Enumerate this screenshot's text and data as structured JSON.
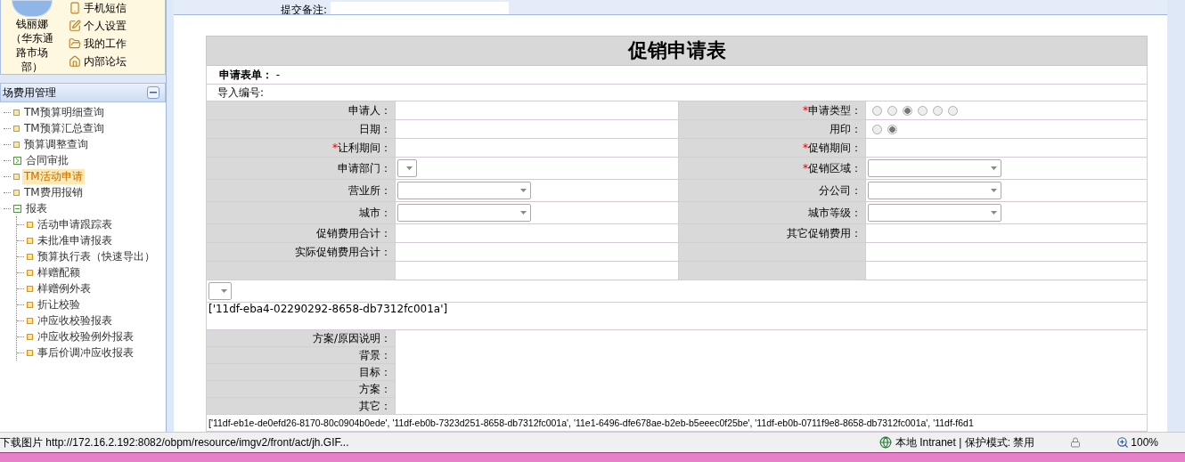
{
  "toolbar": {
    "label": "提交备注:"
  },
  "user": {
    "name": "钱丽娜（华东通路市场部）",
    "links": [
      "手机短信",
      "个人设置",
      "我的工作",
      "内部论坛"
    ]
  },
  "menu": {
    "title": "场费用管理",
    "items": [
      {
        "label": "TM预算明细查询",
        "selected": false
      },
      {
        "label": "TM预算汇总查询",
        "selected": false
      },
      {
        "label": "预算调整查询",
        "selected": false
      },
      {
        "label": "合同审批",
        "selected": false,
        "expanded": false
      },
      {
        "label": "TM活动申请",
        "selected": true
      },
      {
        "label": "TM费用报销",
        "selected": false
      },
      {
        "label": "报表",
        "selected": false,
        "expanded": true,
        "children": [
          {
            "label": "活动申请跟踪表",
            "selected": false
          },
          {
            "label": "未批准申请报表",
            "selected": false
          },
          {
            "label": "预算执行表（快速导出）",
            "selected": false
          },
          {
            "label": "样赠配额",
            "selected": false
          },
          {
            "label": "样赠例外表",
            "selected": false
          },
          {
            "label": "折让校验",
            "selected": false
          },
          {
            "label": "冲应收校验报表",
            "selected": false
          },
          {
            "label": "冲应收校验例外报表",
            "selected": false
          },
          {
            "label": "事后价调冲应收报表",
            "selected": false
          }
        ]
      }
    ]
  },
  "form": {
    "title": "促销申请表",
    "required_mark": "*",
    "form_no_label": "申请表单：",
    "form_no": "-",
    "import_label": "导入编号:",
    "rows": [
      {
        "left": {
          "label": "申请人：",
          "required": false,
          "kind": "text"
        },
        "right": {
          "label": "申请类型：",
          "required": true,
          "kind": "radio",
          "options": [
            {
              "selected": false
            },
            {
              "selected": false
            },
            {
              "selected": true
            },
            {
              "selected": false
            },
            {
              "selected": false
            },
            {
              "selected": false
            }
          ]
        }
      },
      {
        "left": {
          "label": "日期：",
          "required": false,
          "kind": "text"
        },
        "right": {
          "label": "用印：",
          "required": false,
          "kind": "radio",
          "options": [
            {
              "selected": false
            },
            {
              "selected": true
            }
          ]
        }
      },
      {
        "left": {
          "label": "让利期间：",
          "required": true,
          "kind": "text"
        },
        "right": {
          "label": "促销期间：",
          "required": true,
          "kind": "text"
        }
      },
      {
        "left": {
          "label": "申请部门：",
          "required": false,
          "kind": "narrow-select"
        },
        "right": {
          "label": "促销区域：",
          "required": true,
          "kind": "select"
        }
      },
      {
        "left": {
          "label": "营业所：",
          "required": false,
          "kind": "select"
        },
        "right": {
          "label": "分公司：",
          "required": false,
          "kind": "select"
        }
      },
      {
        "left": {
          "label": "城市：",
          "required": false,
          "kind": "select"
        },
        "right": {
          "label": "城市等级：",
          "required": false,
          "kind": "select"
        }
      },
      {
        "left": {
          "label": "促销费用合计：",
          "required": false,
          "kind": "text"
        },
        "right": {
          "label": "其它促销费用：",
          "required": false,
          "kind": "text"
        }
      },
      {
        "left": {
          "label": "实际促销费用合计：",
          "required": false,
          "kind": "text"
        },
        "right": {
          "required": false,
          "kind": "text"
        }
      },
      {
        "left": {
          "required": false,
          "kind": "text"
        },
        "right": {
          "required": false,
          "kind": "text"
        }
      }
    ],
    "id_text": "['11df-eba4-02290292-8658-db7312fc001a']",
    "plan_labels": [
      "方案/原因说明：",
      "背景：",
      "目标：",
      "方案：",
      "其它："
    ],
    "id_list": "['11df-eb1e-de0efd26-8170-80c0904b0ede', '11df-eb0b-7323d251-8658-db7312fc001a', '11e1-6496-dfe678ae-b2eb-b5eeec0f25be', '11df-eb0b-0711f9e8-8658-db7312fc001a', '11df-f6d1"
  },
  "status_bar": {
    "text": "下载图片 http://172.16.2.192:8082/obpm/resource/imgv2/front/act/jh.GIF...",
    "zone": "本地 Intranet | 保护模式: 禁用",
    "zoom": "100%"
  }
}
